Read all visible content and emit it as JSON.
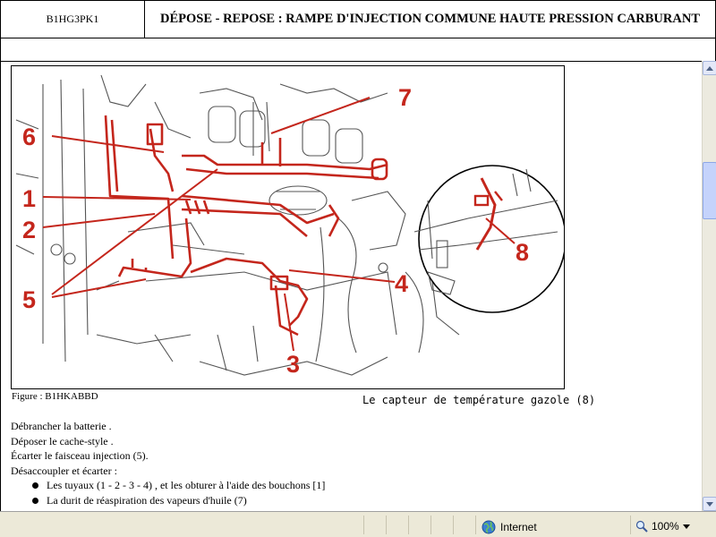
{
  "header": {
    "code": "B1HG3PK1",
    "title": "DÉPOSE - REPOSE : RAMPE D'INJECTION COMMUNE HAUTE PRESSION CARBURANT"
  },
  "figure": {
    "callouts": [
      "1",
      "2",
      "3",
      "4",
      "5",
      "6",
      "7",
      "8"
    ],
    "caption": "Figure : B1HKABBD",
    "subtitle": "Le capteur de température gazole (8)"
  },
  "steps": {
    "lines": [
      "Débrancher la batterie .",
      "Déposer le cache-style .",
      "Écarter le faisceau injection (5).",
      "Désaccoupler et écarter :"
    ],
    "bullets": [
      "Les tuyaux (1 - 2 - 3 - 4) , et les obturer à l'aide des bouchons [1]",
      "La durit de réaspiration des vapeurs d'huile (7)"
    ]
  },
  "statusbar": {
    "zone": "Internet",
    "zoom": "100%"
  }
}
